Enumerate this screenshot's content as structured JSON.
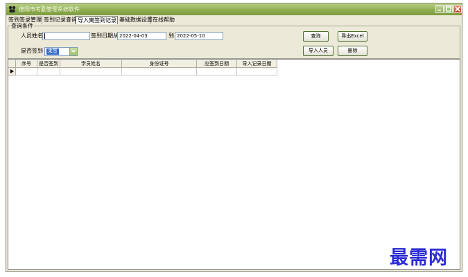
{
  "window": {
    "title": "德阳市考勤管理系统软件",
    "controls": [
      "minimize-icon",
      "maximize-icon",
      "close-icon"
    ]
  },
  "menu": {
    "tabs": [
      {
        "label": "签到签录管理",
        "active": false
      },
      {
        "label": "签到记录查询",
        "active": false
      },
      {
        "label": "导入离签到记录",
        "active": true
      },
      {
        "label": "基础数据设置",
        "active": false
      },
      {
        "label": "在线帮助",
        "active": false
      }
    ]
  },
  "query": {
    "group_label": "查询条件",
    "name_label": "人员姓名",
    "name_value": "",
    "date_from_label": "签到日期从",
    "date_from_value": "2022-04-03",
    "date_to_label": "到",
    "date_to_value": "2022-05-10",
    "signed_label": "是否签到",
    "signed_value": "未签",
    "buttons": {
      "query": "查询",
      "export": "导出Excel",
      "import": "导入人员",
      "delete": "删除"
    }
  },
  "table": {
    "columns": [
      "序号",
      "是否签到",
      "学员姓名",
      "身份证号",
      "应签到日期",
      "导入记录日期"
    ]
  },
  "watermark": "最需网",
  "colors": {
    "titlebar": "#8fae4f",
    "background": "#ece9d8",
    "selection": "#316ac5",
    "watermark": "#2b2bd6"
  }
}
